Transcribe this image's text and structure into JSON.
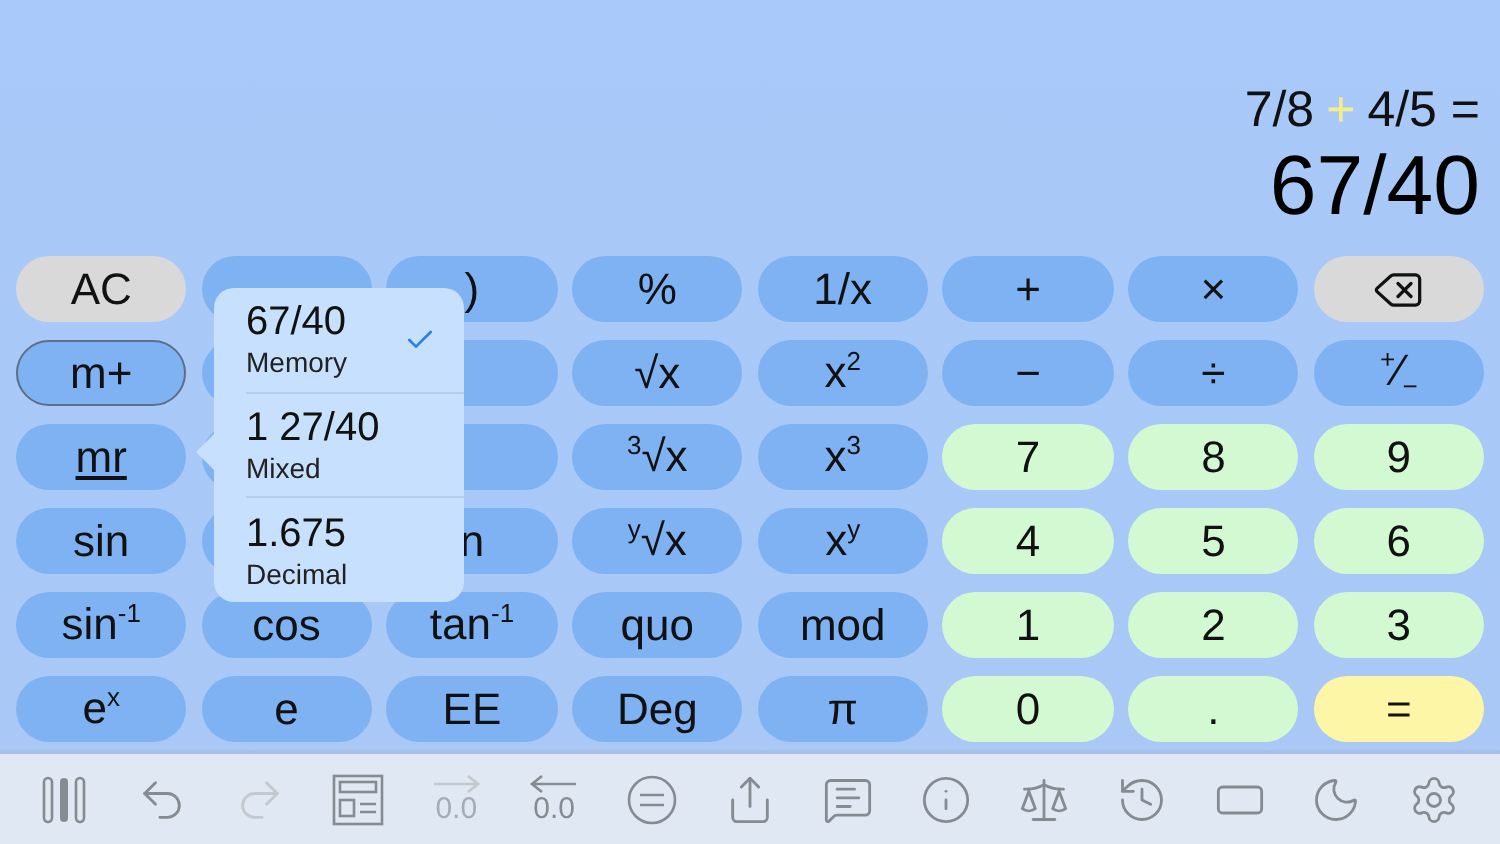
{
  "display": {
    "expression": [
      {
        "text": "7/8",
        "kind": "operand"
      },
      {
        "text": "+",
        "kind": "operator"
      },
      {
        "text": "4/5 =",
        "kind": "operand"
      }
    ],
    "result": "67/40"
  },
  "keys": [
    {
      "label": "AC",
      "kind": "clear"
    },
    {
      "kind": "fn"
    },
    {
      "label": ")",
      "kind": "fn"
    },
    {
      "label": "%",
      "kind": "fn"
    },
    {
      "label": "1/x",
      "kind": "fn"
    },
    {
      "label": "+",
      "kind": "fn"
    },
    {
      "label": "×",
      "kind": "fn"
    },
    {
      "kind": "backspace"
    },
    {
      "label": "m+",
      "kind": "fn",
      "outlined": true
    },
    {
      "kind": "fn"
    },
    {
      "kind": "fn"
    },
    {
      "label": "√x",
      "kind": "fn"
    },
    {
      "label": "x$^{2}$",
      "kind": "fn"
    },
    {
      "label": "−",
      "kind": "fn"
    },
    {
      "label": "÷",
      "kind": "fn"
    },
    {
      "label": "$^{+}$∕$_{−}$",
      "kind": "fn"
    },
    {
      "label": "mr",
      "kind": "fn",
      "underlined": true
    },
    {
      "kind": "fn"
    },
    {
      "kind": "fn"
    },
    {
      "label": "$^{3}$√x",
      "kind": "fn"
    },
    {
      "label": "x$^{3}$",
      "kind": "fn"
    },
    {
      "label": "7",
      "kind": "digit"
    },
    {
      "label": "8",
      "kind": "digit"
    },
    {
      "label": "9",
      "kind": "digit"
    },
    {
      "label": "sin",
      "kind": "fn"
    },
    {
      "kind": "fn"
    },
    {
      "label": "n",
      "kind": "fn"
    },
    {
      "label": "$^{y}$√x",
      "kind": "fn"
    },
    {
      "label": "x$^{y}$",
      "kind": "fn"
    },
    {
      "label": "4",
      "kind": "digit"
    },
    {
      "label": "5",
      "kind": "digit"
    },
    {
      "label": "6",
      "kind": "digit"
    },
    {
      "label": "sin$^{-1}$",
      "kind": "fn"
    },
    {
      "label": "cos",
      "kind": "fn"
    },
    {
      "label": "tan$^{-1}$",
      "kind": "fn"
    },
    {
      "label": "quo",
      "kind": "fn"
    },
    {
      "label": "mod",
      "kind": "fn"
    },
    {
      "label": "1",
      "kind": "digit"
    },
    {
      "label": "2",
      "kind": "digit"
    },
    {
      "label": "3",
      "kind": "digit"
    },
    {
      "label": "e$^{x}$",
      "kind": "fn"
    },
    {
      "label": "e",
      "kind": "fn"
    },
    {
      "label": "EE",
      "kind": "fn"
    },
    {
      "label": "Deg",
      "kind": "fn"
    },
    {
      "label": "π",
      "kind": "fn"
    },
    {
      "label": "0",
      "kind": "digit"
    },
    {
      "label": ".",
      "kind": "digit"
    },
    {
      "label": "=",
      "kind": "equals"
    }
  ],
  "memory_popover": {
    "items": [
      {
        "value": "67/40",
        "label": "Memory",
        "selected": true
      },
      {
        "value": "1 27/40",
        "label": "Mixed",
        "selected": false
      },
      {
        "value": "1.675",
        "label": "Decimal",
        "selected": false
      }
    ]
  },
  "toolbar": [
    {
      "kind": "columns",
      "disabled": false
    },
    {
      "kind": "undo",
      "disabled": false
    },
    {
      "kind": "redo",
      "disabled": true
    },
    {
      "kind": "layout",
      "disabled": false
    },
    {
      "kind": "to-decimal",
      "text": "0.0",
      "disabled": true
    },
    {
      "kind": "from-decimal",
      "text": "0.0",
      "disabled": false
    },
    {
      "kind": "equals-circle",
      "disabled": false
    },
    {
      "kind": "share",
      "disabled": false
    },
    {
      "kind": "comment",
      "disabled": false
    },
    {
      "kind": "info",
      "disabled": false
    },
    {
      "kind": "scale",
      "disabled": false
    },
    {
      "kind": "history",
      "disabled": false
    },
    {
      "kind": "rectangle",
      "disabled": false
    },
    {
      "kind": "moon",
      "disabled": false
    },
    {
      "kind": "settings",
      "disabled": false
    }
  ]
}
